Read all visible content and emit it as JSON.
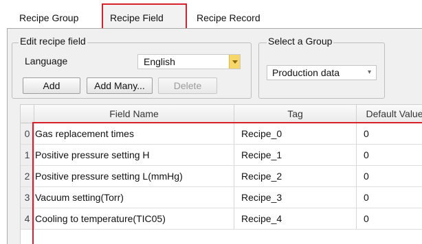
{
  "tabs": [
    {
      "label": "Recipe Group",
      "active": false
    },
    {
      "label": "Recipe Field",
      "active": true
    },
    {
      "label": "Recipe Record",
      "active": false
    }
  ],
  "edit_group": {
    "title": "Edit recipe field",
    "language_label": "Language",
    "language_value": "English",
    "buttons": {
      "add": "Add",
      "add_many": "Add Many...",
      "delete": "Delete"
    }
  },
  "select_group": {
    "title": "Select a Group",
    "value": "Production data"
  },
  "table": {
    "columns": [
      "Field Name",
      "Tag",
      "Default Value"
    ],
    "rows": [
      {
        "index": "0",
        "name": "Gas replacement times",
        "tag": "Recipe_0",
        "default": "0"
      },
      {
        "index": "1",
        "name": "Positive pressure setting H",
        "tag": "Recipe_1",
        "default": "0"
      },
      {
        "index": "2",
        "name": "Positive pressure setting L(mmHg)",
        "tag": "Recipe_2",
        "default": "0"
      },
      {
        "index": "3",
        "name": "Vacuum setting(Torr)",
        "tag": "Recipe_3",
        "default": "0"
      },
      {
        "index": "4",
        "name": "Cooling to temperature(TIC05)",
        "tag": "Recipe_4",
        "default": "0"
      }
    ]
  },
  "colors": {
    "highlight": "#d9202a",
    "dropdown_accent": "#f7d76a"
  }
}
